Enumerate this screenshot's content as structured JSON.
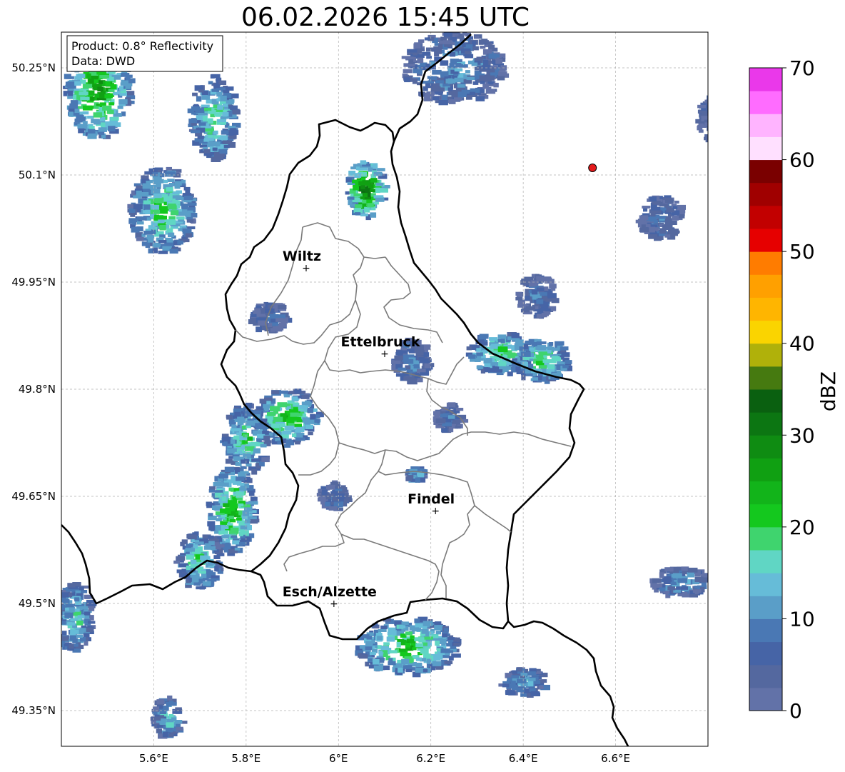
{
  "title": "06.02.2026 15:45 UTC",
  "info_box": {
    "line1": "Product: 0.8° Reflectivity",
    "line2": "Data: DWD"
  },
  "map": {
    "lon_range": [
      5.4,
      6.8
    ],
    "lat_range": [
      49.3,
      50.3
    ],
    "lon_ticks": [
      {
        "value": 5.6,
        "label": "5.6°E"
      },
      {
        "value": 5.8,
        "label": "5.8°E"
      },
      {
        "value": 6.0,
        "label": "6°E"
      },
      {
        "value": 6.2,
        "label": "6.2°E"
      },
      {
        "value": 6.4,
        "label": "6.4°E"
      },
      {
        "value": 6.6,
        "label": "6.6°E"
      }
    ],
    "lat_ticks": [
      {
        "value": 50.25,
        "label": "50.25°N"
      },
      {
        "value": 50.1,
        "label": "50.1°N"
      },
      {
        "value": 49.95,
        "label": "49.95°N"
      },
      {
        "value": 49.8,
        "label": "49.8°N"
      },
      {
        "value": 49.65,
        "label": "49.65°N"
      },
      {
        "value": 49.5,
        "label": "49.5°N"
      },
      {
        "value": 49.35,
        "label": "49.35°N"
      }
    ],
    "cities": [
      {
        "name": "Wiltz",
        "lon": 5.93,
        "lat": 49.97
      },
      {
        "name": "Ettelbruck",
        "lon": 6.1,
        "lat": 49.85
      },
      {
        "name": "Findel",
        "lon": 6.21,
        "lat": 49.63
      },
      {
        "name": "Esch/Alzette",
        "lon": 5.99,
        "lat": 49.5
      }
    ],
    "radar_site": {
      "lon": 6.55,
      "lat": 50.11,
      "color": "#e41a1c"
    }
  },
  "colorbar": {
    "label": "dBZ",
    "min": 0,
    "max": 70,
    "ticks": [
      {
        "value": 0,
        "label": "0"
      },
      {
        "value": 10,
        "label": "10"
      },
      {
        "value": 20,
        "label": "20"
      },
      {
        "value": 30,
        "label": "30"
      },
      {
        "value": 40,
        "label": "40"
      },
      {
        "value": 50,
        "label": "50"
      },
      {
        "value": 60,
        "label": "60"
      },
      {
        "value": 70,
        "label": "70"
      }
    ],
    "colors": [
      "#6272a8",
      "#54689f",
      "#4664a6",
      "#4a78b4",
      "#5a9ec8",
      "#66bcd8",
      "#60d6c4",
      "#3fd46e",
      "#14c81e",
      "#12b41a",
      "#10a012",
      "#0f8c12",
      "#0c7612",
      "#0a6010",
      "#467a10",
      "#b0b10a",
      "#fad400",
      "#ffb500",
      "#ffa000",
      "#ff7c00",
      "#e60000",
      "#c20000",
      "#a00000",
      "#7a0000",
      "#ffe0ff",
      "#ffb4ff",
      "#ff6cff",
      "#ea38ea"
    ]
  },
  "echoes": [
    {
      "lon": 5.48,
      "lat": 50.22,
      "rlon": 0.07,
      "rlat": 0.07,
      "level": 28
    },
    {
      "lon": 5.62,
      "lat": 50.05,
      "rlon": 0.07,
      "rlat": 0.06,
      "level": 22
    },
    {
      "lon": 5.73,
      "lat": 50.18,
      "rlon": 0.05,
      "rlat": 0.06,
      "level": 20
    },
    {
      "lon": 6.06,
      "lat": 50.08,
      "rlon": 0.04,
      "rlat": 0.04,
      "level": 34
    },
    {
      "lon": 6.25,
      "lat": 50.25,
      "rlon": 0.11,
      "rlat": 0.05,
      "level": 12
    },
    {
      "lon": 6.35,
      "lat": 49.85,
      "rlon": 0.07,
      "rlat": 0.03,
      "level": 22
    },
    {
      "lon": 6.44,
      "lat": 49.84,
      "rlon": 0.06,
      "rlat": 0.03,
      "level": 22
    },
    {
      "lon": 6.16,
      "lat": 49.84,
      "rlon": 0.04,
      "rlat": 0.03,
      "level": 10
    },
    {
      "lon": 5.89,
      "lat": 49.76,
      "rlon": 0.07,
      "rlat": 0.04,
      "level": 24
    },
    {
      "lon": 5.8,
      "lat": 49.73,
      "rlon": 0.05,
      "rlat": 0.05,
      "level": 20
    },
    {
      "lon": 5.77,
      "lat": 49.63,
      "rlon": 0.05,
      "rlat": 0.06,
      "level": 26
    },
    {
      "lon": 5.7,
      "lat": 49.56,
      "rlon": 0.05,
      "rlat": 0.04,
      "level": 20
    },
    {
      "lon": 6.15,
      "lat": 49.44,
      "rlon": 0.11,
      "rlat": 0.04,
      "level": 24
    },
    {
      "lon": 5.43,
      "lat": 49.48,
      "rlon": 0.04,
      "rlat": 0.05,
      "level": 18
    },
    {
      "lon": 6.74,
      "lat": 49.53,
      "rlon": 0.06,
      "rlat": 0.02,
      "level": 14
    },
    {
      "lon": 6.83,
      "lat": 50.18,
      "rlon": 0.05,
      "rlat": 0.04,
      "level": 8
    },
    {
      "lon": 6.7,
      "lat": 50.04,
      "rlon": 0.05,
      "rlat": 0.03,
      "level": 8
    },
    {
      "lon": 5.63,
      "lat": 49.34,
      "rlon": 0.03,
      "rlat": 0.03,
      "level": 16
    },
    {
      "lon": 6.43,
      "lat": 49.93,
      "rlon": 0.04,
      "rlat": 0.03,
      "level": 8
    },
    {
      "lon": 6.4,
      "lat": 49.39,
      "rlon": 0.05,
      "rlat": 0.02,
      "level": 14
    },
    {
      "lon": 6.24,
      "lat": 49.76,
      "rlon": 0.03,
      "rlat": 0.02,
      "level": 8
    },
    {
      "lon": 6.17,
      "lat": 49.68,
      "rlon": 0.02,
      "rlat": 0.01,
      "level": 18
    },
    {
      "lon": 5.85,
      "lat": 49.9,
      "rlon": 0.04,
      "rlat": 0.02,
      "level": 8
    },
    {
      "lon": 5.99,
      "lat": 49.65,
      "rlon": 0.03,
      "rlat": 0.02,
      "level": 8
    }
  ]
}
